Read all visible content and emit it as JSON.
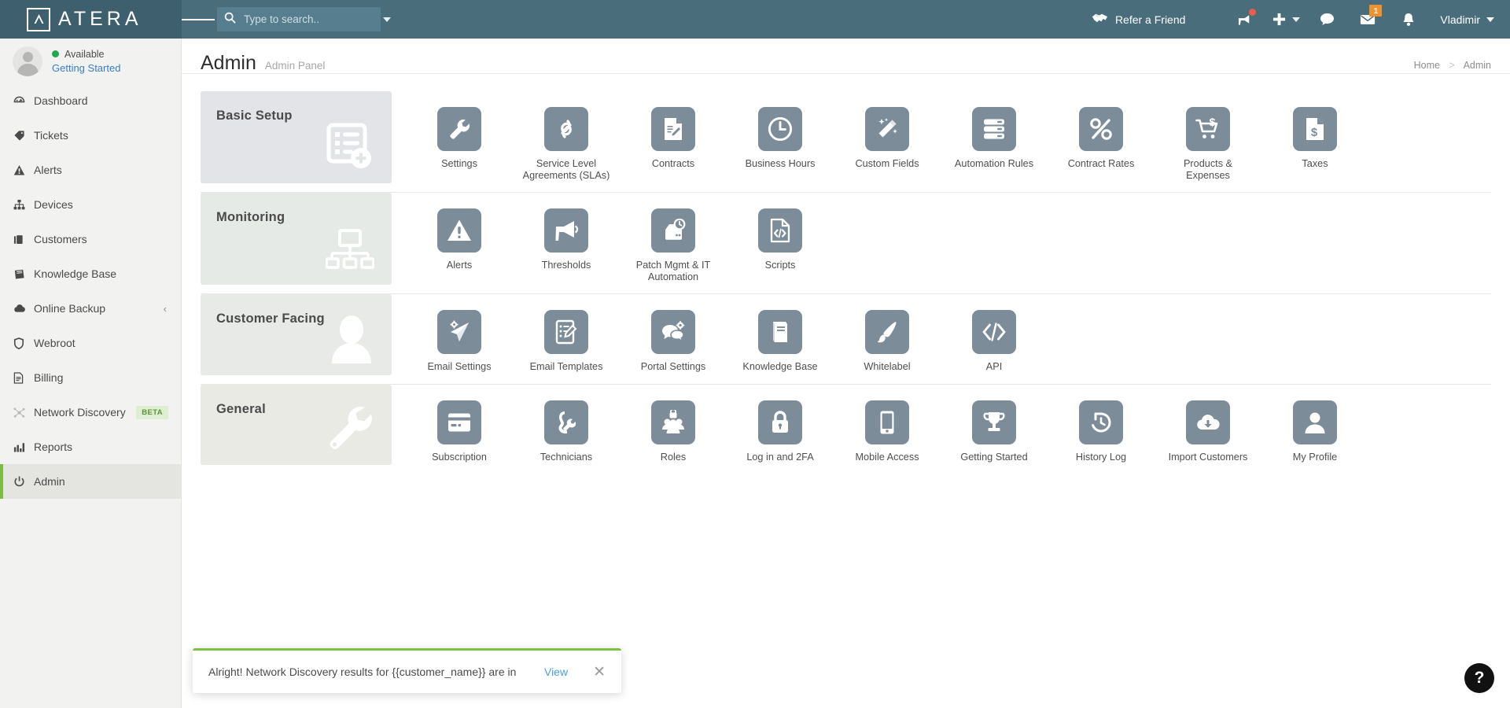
{
  "brand": {
    "name": "ATERA",
    "accent": "#7dbb42",
    "topbar_color": "#4a6d7c",
    "tile_color": "#7c8d99"
  },
  "topbar": {
    "hamburger": "menu-icon",
    "search": {
      "placeholder": "Type to search..",
      "value": ""
    },
    "refer_label": "Refer a Friend",
    "mail_badge": "1",
    "user_name": "Vladimir"
  },
  "sidebar": {
    "profile": {
      "status": "Available",
      "link": "Getting Started"
    },
    "items": [
      {
        "label": "Dashboard",
        "icon": "dashboard-icon",
        "active": false
      },
      {
        "label": "Tickets",
        "icon": "tag-icon",
        "active": false
      },
      {
        "label": "Alerts",
        "icon": "warning-icon",
        "active": false
      },
      {
        "label": "Devices",
        "icon": "sitemap-icon",
        "active": false
      },
      {
        "label": "Customers",
        "icon": "briefcase-icon",
        "active": false
      },
      {
        "label": "Knowledge Base",
        "icon": "book-icon",
        "active": false
      },
      {
        "label": "Online Backup",
        "icon": "cloud-upload-icon",
        "active": false,
        "chevron": "‹"
      },
      {
        "label": "Webroot",
        "icon": "shield-icon",
        "active": false
      },
      {
        "label": "Billing",
        "icon": "file-icon",
        "active": false
      },
      {
        "label": "Network Discovery",
        "icon": "network-icon",
        "active": false,
        "badge": "BETA"
      },
      {
        "label": "Reports",
        "icon": "bar-chart-icon",
        "active": false
      },
      {
        "label": "Admin",
        "icon": "power-icon",
        "active": true
      }
    ]
  },
  "page": {
    "title": "Admin",
    "subtitle": "Admin Panel",
    "breadcrumb": {
      "home": "Home",
      "separator": ">",
      "current": "Admin"
    }
  },
  "sections": [
    {
      "title": "Basic Setup",
      "deco": "checklist-add-icon",
      "tint": "t-basic",
      "tiles": [
        {
          "label": "Settings",
          "icon": "wrench-icon"
        },
        {
          "label": "Service Level Agreements (SLAs)",
          "icon": "links-icon"
        },
        {
          "label": "Contracts",
          "icon": "contract-edit-icon"
        },
        {
          "label": "Business Hours",
          "icon": "clock-icon"
        },
        {
          "label": "Custom Fields",
          "icon": "magic-wand-icon"
        },
        {
          "label": "Automation Rules",
          "icon": "server-rules-icon"
        },
        {
          "label": "Contract Rates",
          "icon": "percent-icon"
        },
        {
          "label": "Products & Expenses",
          "icon": "cart-dollar-icon"
        },
        {
          "label": "Taxes",
          "icon": "document-dollar-icon"
        }
      ]
    },
    {
      "title": "Monitoring",
      "deco": "network-tree-icon",
      "tint": "t-mon",
      "tiles": [
        {
          "label": "Alerts",
          "icon": "warning-triangle-icon"
        },
        {
          "label": "Thresholds",
          "icon": "megaphone-icon"
        },
        {
          "label": "Patch Mgmt & IT Automation",
          "icon": "patch-clock-icon"
        },
        {
          "label": "Scripts",
          "icon": "code-file-icon"
        }
      ]
    },
    {
      "title": "Customer Facing",
      "deco": "person-icon",
      "tint": "t-cust",
      "tiles": [
        {
          "label": "Email Settings",
          "icon": "send-gear-icon"
        },
        {
          "label": "Email Templates",
          "icon": "template-edit-icon"
        },
        {
          "label": "Portal Settings",
          "icon": "chat-gear-icon"
        },
        {
          "label": "Knowledge Base",
          "icon": "book-closed-icon"
        },
        {
          "label": "Whitelabel",
          "icon": "paintbrush-icon"
        },
        {
          "label": "API",
          "icon": "code-brackets-icon"
        }
      ]
    },
    {
      "title": "General",
      "deco": "wrench-deco-icon",
      "tint": "t-gen",
      "tiles": [
        {
          "label": "Subscription",
          "icon": "credit-card-icon"
        },
        {
          "label": "Technicians",
          "icon": "technician-icon"
        },
        {
          "label": "Roles",
          "icon": "users-lock-icon"
        },
        {
          "label": "Log in and 2FA",
          "icon": "padlock-icon"
        },
        {
          "label": "Mobile Access",
          "icon": "mobile-icon"
        },
        {
          "label": "Getting Started",
          "icon": "trophy-icon"
        },
        {
          "label": "History Log",
          "icon": "history-icon"
        },
        {
          "label": "Import Customers",
          "icon": "cloud-download-icon"
        },
        {
          "label": "My Profile",
          "icon": "profile-icon"
        }
      ]
    }
  ],
  "toast": {
    "message": "Alright! Network Discovery results for {{customer_name}} are in",
    "action": "View",
    "close": "✕",
    "accent": "#7dc242"
  },
  "help": {
    "label": "?"
  }
}
